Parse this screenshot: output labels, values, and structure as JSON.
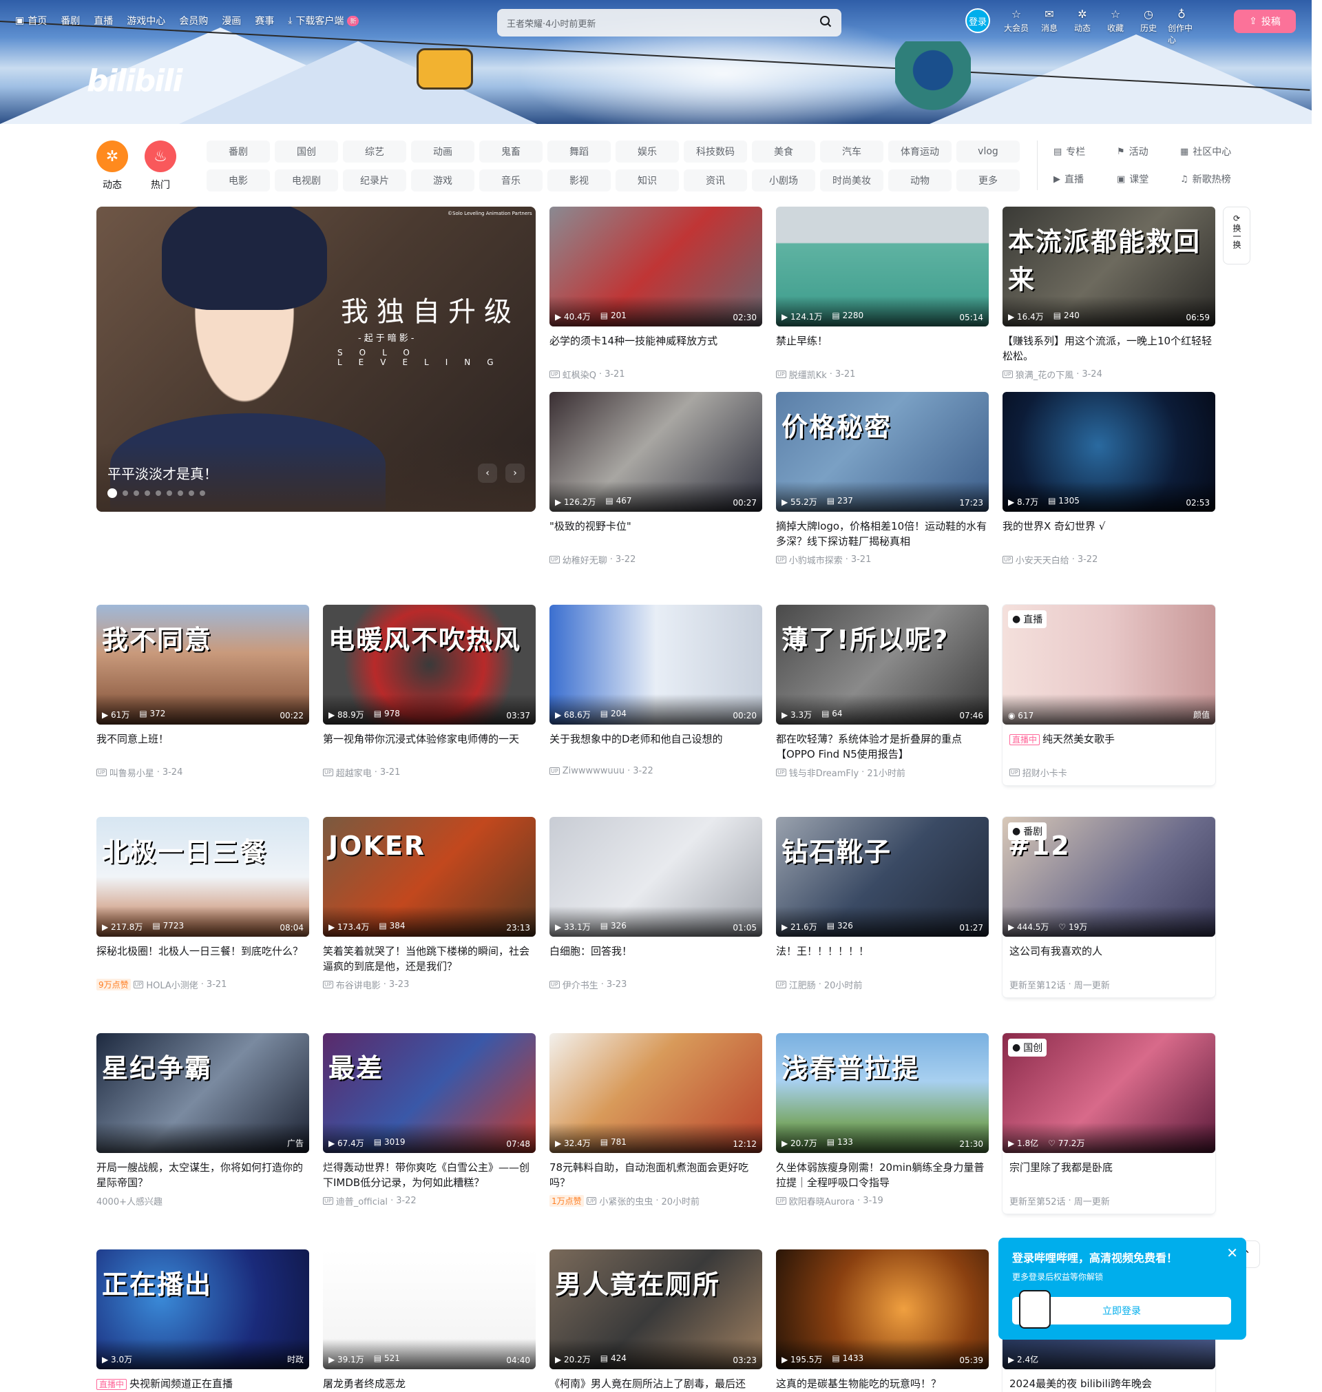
{
  "topnav": [
    {
      "label": "首页",
      "icon": "tv-icon"
    },
    {
      "label": "番剧"
    },
    {
      "label": "直播"
    },
    {
      "label": "游戏中心"
    },
    {
      "label": "会员购"
    },
    {
      "label": "漫画"
    },
    {
      "label": "赛事"
    },
    {
      "label": "下载客户端",
      "icon": "download-icon",
      "badge": "新"
    }
  ],
  "search": {
    "placeholder": "王者荣耀·4小时前更新"
  },
  "logo": "bilibili",
  "login_label": "登录",
  "rightnav": [
    {
      "label": "大会员",
      "icon": "vip-icon"
    },
    {
      "label": "消息",
      "icon": "mail-icon"
    },
    {
      "label": "动态",
      "icon": "wind-icon"
    },
    {
      "label": "收藏",
      "icon": "star-icon"
    },
    {
      "label": "历史",
      "icon": "clock-icon"
    },
    {
      "label": "创作中心",
      "icon": "bulb-icon"
    }
  ],
  "upload_label": "投稿",
  "channels": [
    {
      "label": "动态",
      "color": "#ff8a1e",
      "icon": "wind-icon"
    },
    {
      "label": "热门",
      "color": "#f9585b",
      "icon": "flame-icon"
    }
  ],
  "tags": [
    "番剧",
    "国创",
    "综艺",
    "动画",
    "鬼畜",
    "舞蹈",
    "娱乐",
    "科技数码",
    "美食",
    "汽车",
    "体育运动",
    "vlog",
    "电影",
    "电视剧",
    "纪录片",
    "游戏",
    "音乐",
    "影视",
    "知识",
    "资讯",
    "小剧场",
    "时尚美妆",
    "动物",
    "更多"
  ],
  "links": [
    {
      "label": "专栏",
      "icon": "article-icon"
    },
    {
      "label": "活动",
      "icon": "flag-icon"
    },
    {
      "label": "社区中心",
      "icon": "community-icon"
    },
    {
      "label": "直播",
      "icon": "live-icon"
    },
    {
      "label": "课堂",
      "icon": "class-icon"
    },
    {
      "label": "新歌热榜",
      "icon": "music-icon"
    }
  ],
  "carousel": {
    "title_cn": "我独自升级",
    "subtitle": "-起于暗影-",
    "title_en": "SOLO LEVELING",
    "copyright": "©Solo Leveling Animation Partners",
    "caption": "平平淡淡才是真！",
    "slides": 9,
    "active": 1
  },
  "refresh_label": "换一换",
  "cards": [
    {
      "title": "必学的须卡14种一技能神威释放方式",
      "views": "40.4万",
      "danmaku": "201",
      "duration": "02:30",
      "author": "虹枫染Q",
      "date": "3-21",
      "bg": "linear-gradient(135deg,#8a8a92,#c03535 50%,#6a6670)"
    },
    {
      "title": "禁止早练！",
      "views": "124.1万",
      "danmaku": "2280",
      "duration": "05:14",
      "author": "脱缰凯Kk",
      "date": "3-21",
      "bg": "linear-gradient(180deg,#cfd7dc 0,#cfd7dc 30%,#5fb3a2 31%,#3a9a8a 100%)"
    },
    {
      "title": "【赚钱系列】用这个流派，一晚上10个红轻轻松松。",
      "views": "16.4万",
      "danmaku": "240",
      "duration": "06:59",
      "author": "狼满_花の下風",
      "date": "3-24",
      "bg": "linear-gradient(135deg,#3a3a36,#6d6a5e 50%,#2c2b28)",
      "overlay": "本流派都能救回来"
    },
    {
      "title": "\"极致的视野卡位\"",
      "views": "126.2万",
      "danmaku": "467",
      "duration": "00:27",
      "author": "幼稚好无聊",
      "date": "3-22",
      "bg": "linear-gradient(135deg,#3a2f33,#a8a6a2 45%,#2c2e3c)"
    },
    {
      "title": "摘掉大牌logo，价格相差10倍！运动鞋的水有多深？线下探访鞋厂揭秘真相",
      "views": "55.2万",
      "danmaku": "237",
      "duration": "17:23",
      "author": "小豹城市探索",
      "date": "3-21",
      "bg": "linear-gradient(135deg,#5b7fa8,#7aa0c4 40%,#3b5c88)",
      "overlay": "价格秘密"
    },
    {
      "title": "我的世界X 奇幻世界 √",
      "views": "8.7万",
      "danmaku": "1305",
      "duration": "02:53",
      "author": "小安天天白给",
      "date": "3-22",
      "bg": "radial-gradient(circle at 45% 45%,#2a6aa0,#0c1c38 60%,#050a18)"
    },
    {
      "title": "我不同意上班！",
      "views": "61万",
      "danmaku": "372",
      "duration": "00:22",
      "author": "叫鲁易小星",
      "date": "3-24",
      "bg": "linear-gradient(180deg,#9fb8d8,#c99a7c 40%,#7b4a32 100%)",
      "overlay": "我不同意"
    },
    {
      "title": "第一视角带你沉浸式体验修家电师傅的一天",
      "views": "88.9万",
      "danmaku": "978",
      "duration": "03:37",
      "author": "超越家电",
      "date": "3-21",
      "bg": "radial-gradient(circle at 50% 50%,#3a3a3a,#b82a2a 45%,#4a4a4a 70%)",
      "overlay": "电暖风不吹热风"
    },
    {
      "title": "关于我想象中的D老师和他自己设想的",
      "views": "68.6万",
      "danmaku": "204",
      "duration": "00:20",
      "author": "Ziwwwwwuuu",
      "date": "3-22",
      "bg": "linear-gradient(90deg,#3b6fd0,#e8eef6 50%,#c8d0dc)"
    },
    {
      "title": "都在吹轻薄？系统体验才是折叠屏的重点【OPPO Find N5使用报告】",
      "views": "3.3万",
      "danmaku": "64",
      "duration": "07:46",
      "author": "钱与非DreamFly",
      "date": "21小时前",
      "bg": "linear-gradient(135deg,#4a4a4a,#8a8a8a 50%,#3a3a3a)",
      "overlay": "薄了!所以呢?"
    },
    {
      "title": "探秘北极圈！北极人一日三餐！到底吃什么？",
      "views": "217.8万",
      "danmaku": "7723",
      "duration": "08:04",
      "author": "HOLA小测佬",
      "date": "3-21",
      "hot": "9万点赞",
      "bg": "linear-gradient(180deg,#d7e6f2,#f0f4f8 50%,#c2744a)",
      "overlay": "北极一日三餐"
    },
    {
      "title": "笑着笑着就哭了！当他跳下楼梯的瞬间，社会逼疯的到底是他，还是我们？",
      "views": "173.4万",
      "danmaku": "384",
      "duration": "23:13",
      "author": "布谷讲电影",
      "date": "3-23",
      "bg": "linear-gradient(135deg,#7a5a40,#c2481e 50%,#5a3a22)",
      "overlay": "JOKER"
    },
    {
      "title": "白细胞：回答我！",
      "views": "33.1万",
      "danmaku": "326",
      "duration": "01:05",
      "author": "伊介书生",
      "date": "3-23",
      "bg": "linear-gradient(135deg,#c8ccd4,#e8eaee 50%,#9ea2aa)"
    },
    {
      "title": "法！王！！！！！！",
      "views": "21.6万",
      "danmaku": "326",
      "duration": "01:27",
      "author": "江肥肠",
      "date": "20小时前",
      "bg": "linear-gradient(135deg,#9aa2ae,#3a4a64 50%,#202838)",
      "overlay": "钻石靴子"
    },
    {
      "title": "开局一艘战舰，太空谋生，你将如何打造你的星际帝国？",
      "ad": "4000+人感兴趣",
      "adlabel": "广告",
      "bg": "linear-gradient(135deg,#1e2a40,#7a8aa0 50%,#1c2232)",
      "overlay": "星纪争霸"
    },
    {
      "title": "烂得轰动世界！带你爽吃《白雪公主》——创下IMDB低分记录，为何如此糟糕？",
      "views": "67.4万",
      "danmaku": "3019",
      "duration": "07:48",
      "author": "迪普_official",
      "date": "3-22",
      "bg": "linear-gradient(135deg,#5a2a6a,#3a58a8 50%,#c83a2a)",
      "overlay": "最差"
    },
    {
      "title": "78元韩料自助，自动泡面机煮泡面会更好吃吗？",
      "views": "32.4万",
      "danmaku": "781",
      "duration": "12:12",
      "author": "小紧张的虫虫",
      "date": "20小时前",
      "hot": "1万点赞",
      "bg": "linear-gradient(135deg,#f2f0ec,#d89a5a 40%,#b8402a)"
    },
    {
      "title": "久坐体弱族瘦身刚需！20min躺练全身力量普拉提｜全程呼吸口令指导",
      "views": "20.7万",
      "danmaku": "133",
      "duration": "21:30",
      "author": "欧阳春晓Aurora",
      "date": "3-19",
      "bg": "linear-gradient(180deg,#7ab0e0,#a8d0f0 40%,#7aa86a 75%,#5a8a4a)",
      "overlay": "浅春普拉提"
    },
    {
      "title": "央视新闻频道正在直播",
      "live": "直播中",
      "author": "",
      "bg": "radial-gradient(circle at 30% 40%,#3a8ad8,#1a2a7a 60%,#101848)",
      "overlay": "正在播出",
      "views": "3.0万",
      "adlabel": "时政"
    },
    {
      "title": "屠龙勇者终成恶龙",
      "views": "39.1万",
      "danmaku": "521",
      "duration": "04:40",
      "bg": "linear-gradient(180deg,#ffffff,#f2f2f2)"
    },
    {
      "title": "《柯南》男人竟在厕所沾上了剧毒，最后还",
      "views": "20.2万",
      "danmaku": "424",
      "duration": "03:23",
      "bg": "linear-gradient(135deg,#7a6a5a,#3a3a3a 50%,#a08060)",
      "overlay": "男人竟在厕所"
    },
    {
      "title": "这真的是碳基生物能吃的玩意吗！？",
      "views": "195.5万",
      "danmaku": "1433",
      "duration": "05:39",
      "bg": "radial-gradient(circle at 60% 50%,#f0a040,#8a4010 50%,#2a1608)"
    }
  ],
  "side_cards": [
    {
      "corner": "直播",
      "title": "纯天然美女歌手",
      "live": "直播中",
      "viewers": "617",
      "extra": "颜值",
      "author": "招财小卡卡",
      "bg": "linear-gradient(90deg,#f4e0dc,#e8c8c8 50%,#c89898)"
    },
    {
      "corner": "番剧",
      "title": "这公司有我喜欢的人",
      "views": "444.5万",
      "likes": "19万",
      "update": "更新至第12话",
      "schedule": "周一更新",
      "bg": "linear-gradient(135deg,#d8c8b8,#6a6a8a 60%,#3a3a5a)",
      "overlay": "#12"
    },
    {
      "corner": "国创",
      "title": "宗门里除了我都是卧底",
      "views": "1.8亿",
      "likes": "77.2万",
      "update": "更新至第52话",
      "schedule": "周一更新",
      "bg": "linear-gradient(135deg,#8a2a4a,#d86a8a 50%,#5a1a3a)"
    },
    {
      "title": "2024最美的夜 bilibili跨年晚会",
      "views": "2.4亿",
      "bg": "linear-gradient(135deg,#1a2a4a,#4a5a8a)"
    }
  ],
  "popup": {
    "title": "登录哔哩哔哩，高清视频免费看！",
    "subtitle": "更多登录后权益等你解锁",
    "button": "立即登录"
  }
}
